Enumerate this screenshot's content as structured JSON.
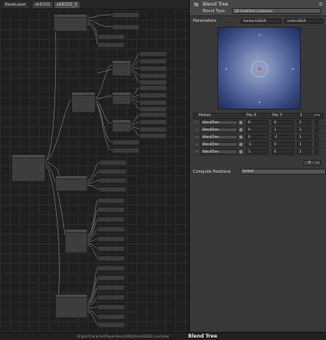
{
  "breadcrumbs": [
    "BaseLayer",
    "skill101",
    "skill102_3"
  ],
  "inspector": {
    "title": "Blend Tree",
    "blend_type_label": "Blend Type",
    "blend_type_value": "2D Freeform Cartesian",
    "parameters_label": "Parameters",
    "param_x": "horizontalSkill",
    "param_y": "verticalSkill",
    "motion_table": {
      "headers": [
        "Motion",
        "Pos X",
        "Pos Y",
        "1"
      ],
      "rows": [
        {
          "motion": "BlendTree",
          "x": "0",
          "y": "0",
          "s": "1"
        },
        {
          "motion": "BlendTree",
          "x": "0",
          "y": "1",
          "s": "1"
        },
        {
          "motion": "BlendTree",
          "x": "0",
          "y": "-1",
          "s": "1"
        },
        {
          "motion": "BlendTree",
          "x": "-1",
          "y": "0",
          "s": "1"
        },
        {
          "motion": "BlendTree",
          "x": "1",
          "y": "0",
          "s": "1"
        }
      ]
    },
    "compute_positions_label": "Compute Positions",
    "compute_positions_value": "Select"
  },
  "footer": {
    "path": "Origin/Character/Player/Hero10002/hero10002.controller",
    "current": "Blend Tree"
  },
  "colors": {
    "panel": "#383838",
    "graph_bg": "#1f1f1f",
    "blend_center": "#98a4c4",
    "blend_edge": "#1e2c5a",
    "point": "#5f9fe6",
    "active_point": "#e04040"
  }
}
